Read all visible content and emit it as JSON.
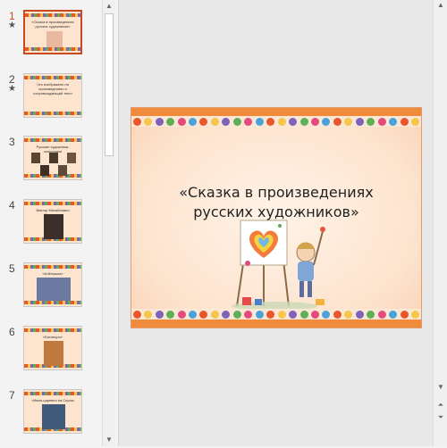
{
  "thumbnails": [
    {
      "number": "1",
      "starred": true,
      "active": true,
      "caption": "«Сказка в произведениях русских художников»"
    },
    {
      "number": "2",
      "starred": true,
      "active": false,
      "caption": "Что изображено на произведениях и сопровождающий текст"
    },
    {
      "number": "3",
      "starred": false,
      "active": false,
      "caption": "Русские художники-сказочники"
    },
    {
      "number": "4",
      "starred": false,
      "active": false,
      "caption": "Виктор Михайлович Васнецов"
    },
    {
      "number": "5",
      "starred": false,
      "active": false,
      "caption": "«Алёнушка»"
    },
    {
      "number": "6",
      "starred": false,
      "active": false,
      "caption": "«Богатыри»"
    },
    {
      "number": "7",
      "starred": false,
      "active": false,
      "caption": "«Иван-царевич на Сером волке»"
    }
  ],
  "slide": {
    "title": "«Сказка в произведениях русских художников»"
  },
  "icons": {
    "star": "star-icon",
    "scroll_up": "scroll-up-arrow-icon",
    "scroll_down": "scroll-down-arrow-icon",
    "prev_slide": "previous-slide-icon",
    "next_slide": "next-slide-icon"
  },
  "colors": {
    "active_border": "#c84a1e",
    "slide_border": "#e39a6d",
    "orange_band": "#f08a3c"
  }
}
